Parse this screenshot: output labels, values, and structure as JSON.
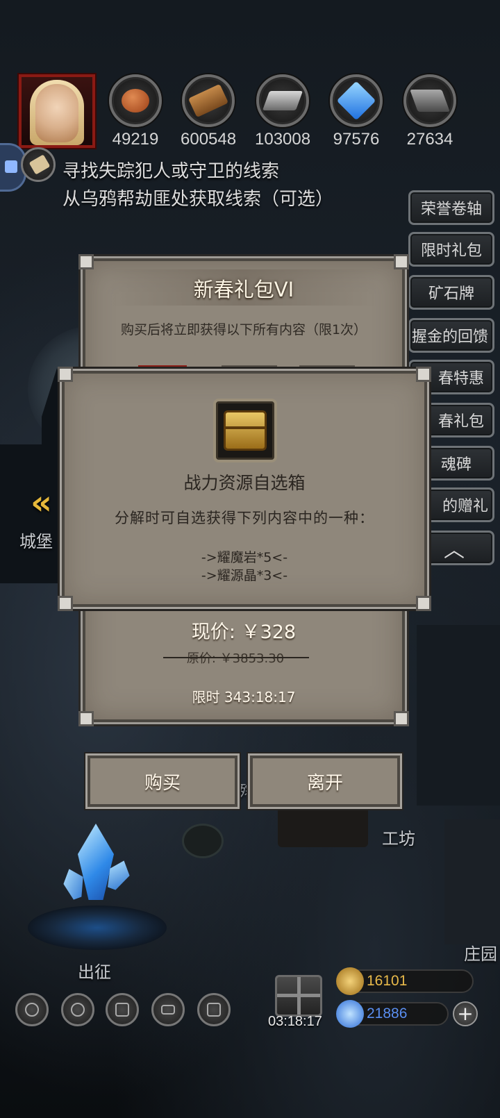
{
  "top_hud": {
    "resources": [
      {
        "icon": "meat-icon",
        "value": "49219"
      },
      {
        "icon": "wood-icon",
        "value": "600548"
      },
      {
        "icon": "iron-icon",
        "value": "103008"
      },
      {
        "icon": "crystal-icon",
        "value": "97576"
      },
      {
        "icon": "ore-icon",
        "value": "27634"
      }
    ],
    "quest": {
      "line1": "寻找失踪犯人或守卫的线索",
      "line2": "从乌鸦帮劫匪处获取线索（可选）"
    }
  },
  "side_menu": [
    "荣誉卷轴",
    "限时礼包",
    "矿石牌",
    "握金的回馈",
    "春特惠",
    "春礼包",
    "魂碑",
    "的赠礼"
  ],
  "scene_labels": {
    "castle": "城堡",
    "workshop": "工坊",
    "manor": "庄园",
    "expedition": "出征",
    "partial": "殇"
  },
  "dialog": {
    "title": "新春礼包VI",
    "subtitle": "购买后将立即获得以下所有内容（限1次）",
    "price_now": "现价: ￥328",
    "price_old": "原价: ￥3853.30",
    "limit": "限时 343:18:17"
  },
  "tooltip": {
    "item_name": "战力资源自选箱",
    "description": "分解时可自选获得下列内容中的一种：",
    "options": [
      "->耀魔岩*5<-",
      "->耀源晶*3<-"
    ]
  },
  "buttons": {
    "buy": "购买",
    "leave": "离开"
  },
  "bottom_hud": {
    "gift_timer": "03:18:17",
    "gold": "16101",
    "gems": "21886",
    "plus_label": "+"
  },
  "colors": {
    "panel": "#8f877b",
    "panel_border": "#4b4741",
    "gold_text": "#e8b94a",
    "gem_text": "#5a8ef0"
  }
}
